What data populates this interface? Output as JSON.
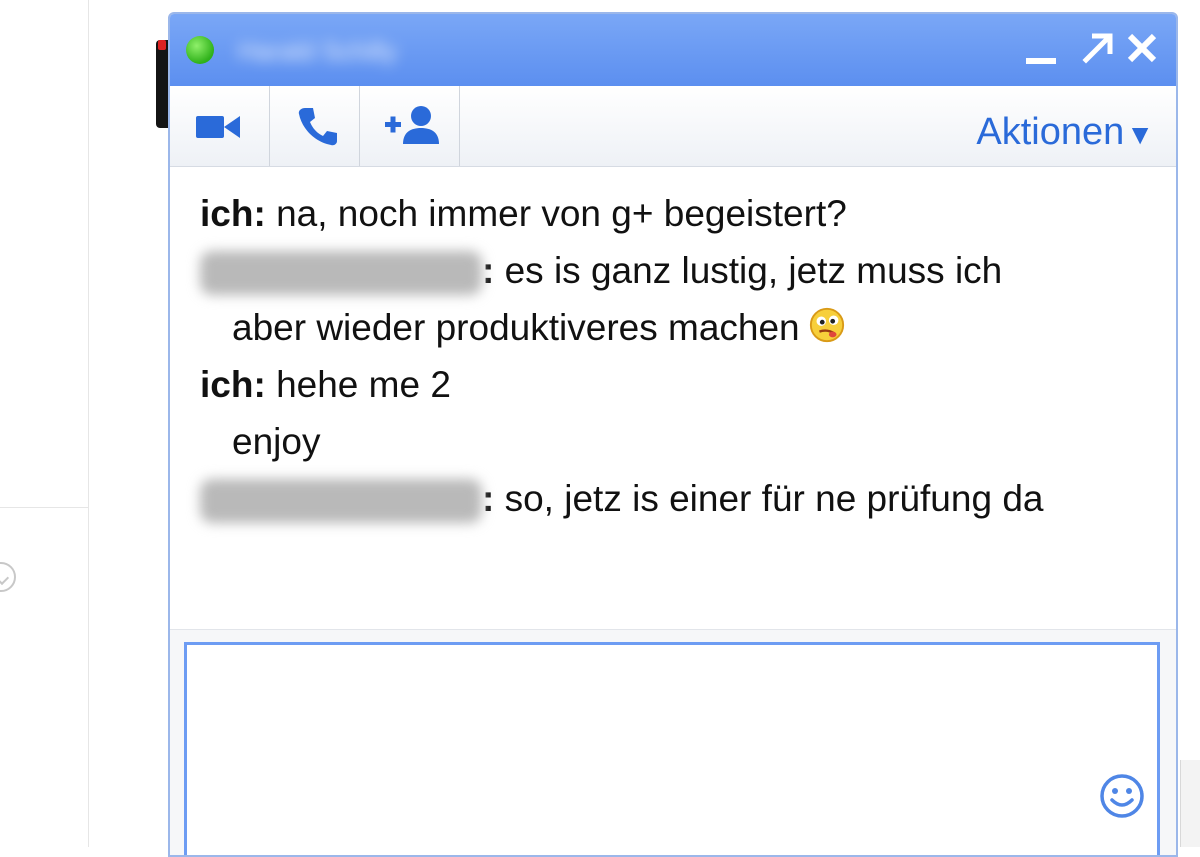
{
  "chat": {
    "contact_name": "Harald Schilly",
    "presence_color": "#2fb11a",
    "window_controls": {
      "minimize_icon": "minimize-icon",
      "popout_icon": "popout-arrow-icon",
      "close_icon": "close-icon"
    },
    "toolbar": {
      "video_icon": "video-camera-icon",
      "phone_icon": "phone-icon",
      "add_person_icon": "add-person-icon",
      "actions_label": "Aktionen",
      "actions_arrow": "▼"
    },
    "messages": [
      {
        "sender": "ich",
        "sender_blurred": false,
        "text": "na, noch immer von g+ begeistert?"
      },
      {
        "sender": "Harald Schilly",
        "sender_blurred": true,
        "text": "es is ganz lustig, jetz muss ich",
        "continuation": "aber wieder produktiveres machen",
        "emoji": "thinking-face-emoji"
      },
      {
        "sender": "ich",
        "sender_blurred": false,
        "text": "hehe me 2",
        "continuation": "enjoy"
      },
      {
        "sender": "Harald Schilly",
        "sender_blurred": true,
        "text": "so, jetz is einer für ne prüfung da"
      }
    ],
    "composer": {
      "value": "",
      "emoji_picker_icon": "smiley-icon"
    },
    "colors": {
      "titlebar": "#6b9bf3",
      "accent_link": "#2a6ad9",
      "input_border": "#6d9cf3"
    }
  }
}
